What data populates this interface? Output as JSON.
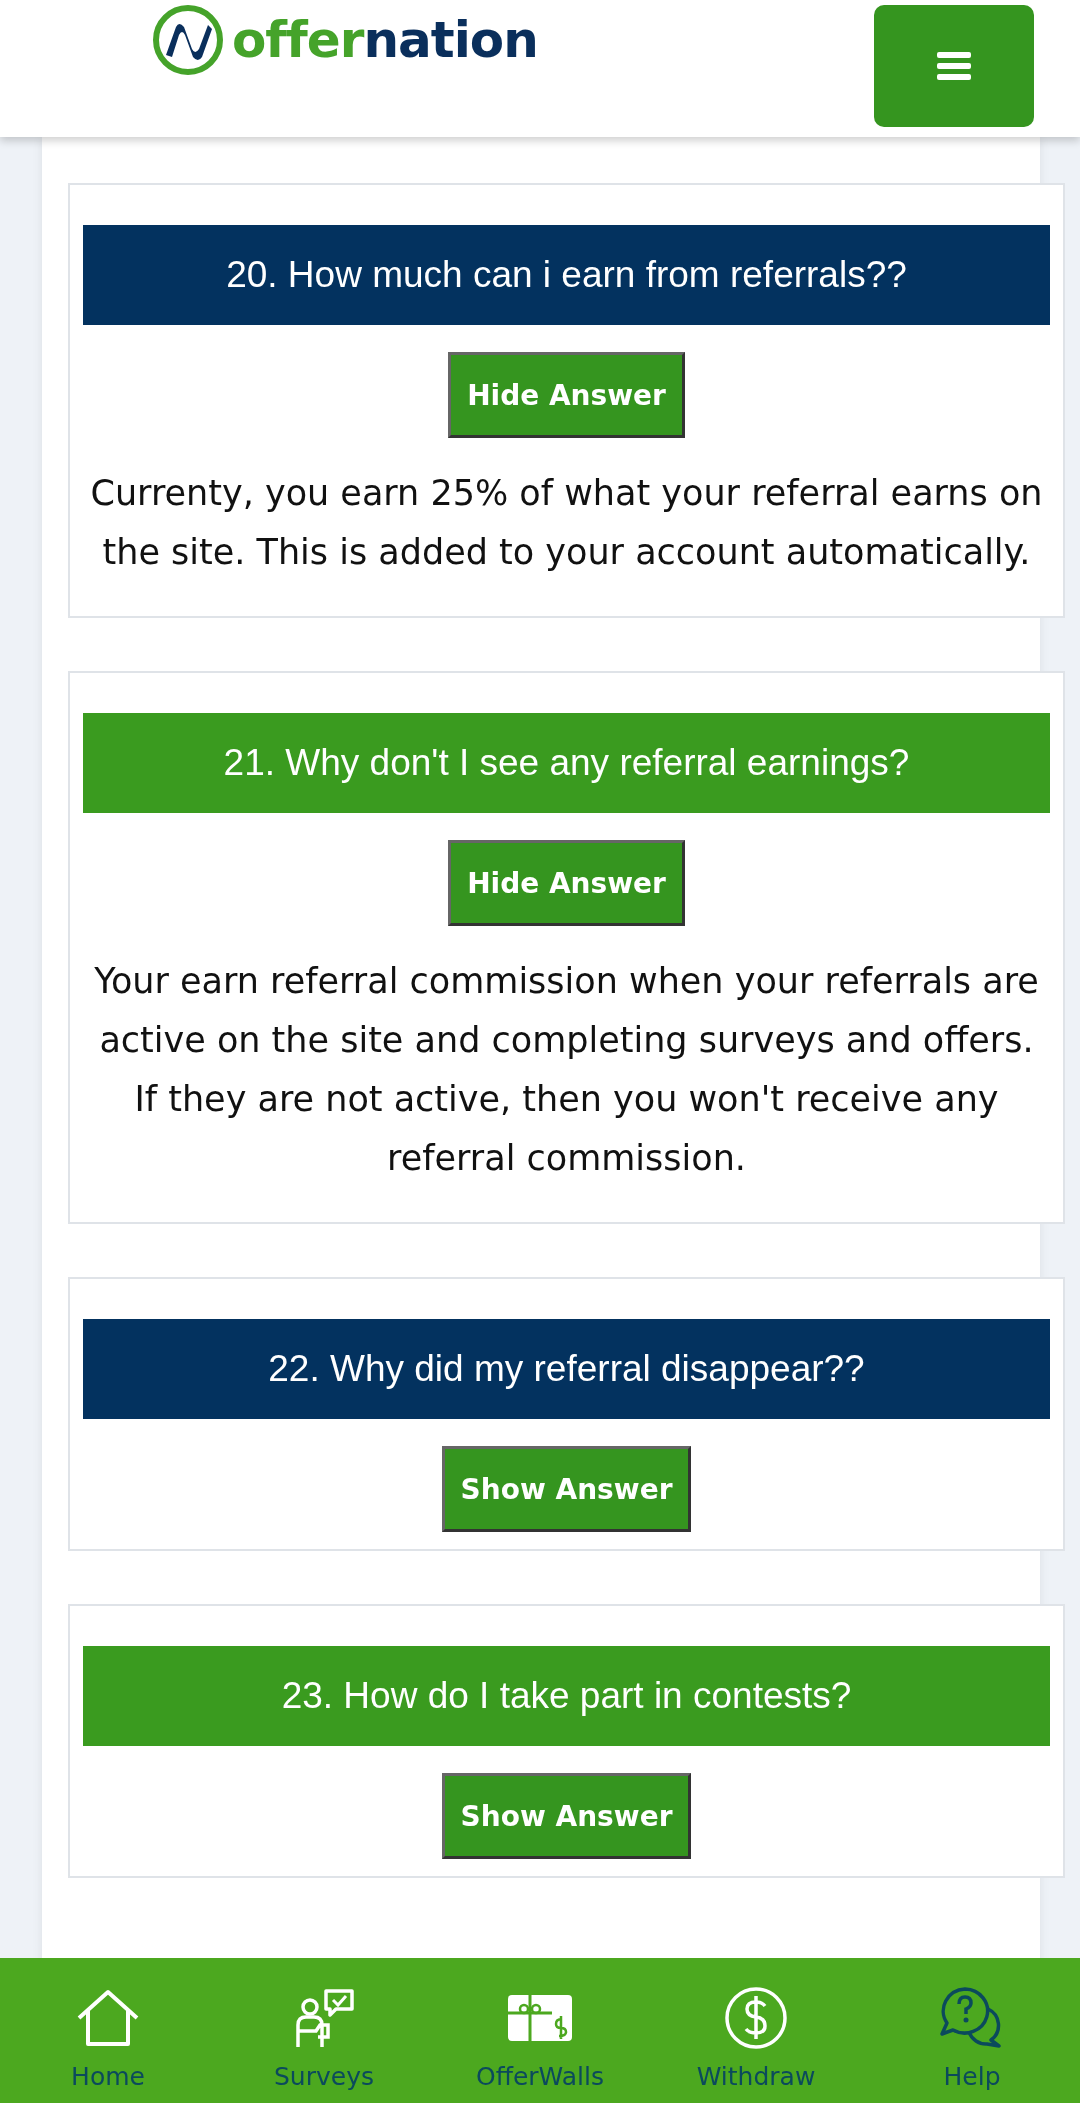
{
  "header": {
    "logo": {
      "first": "offer",
      "second": "nation"
    }
  },
  "faqs": [
    {
      "question": "20. How much can i earn from referrals??",
      "color": "#03325f",
      "button": "Hide Answer",
      "answer": "Currenty, you earn 25% of what your referral earns on the site. This is added to your account automatically."
    },
    {
      "question": "21. Why don't I see any referral earnings?",
      "color": "#3a9b1f",
      "button": "Hide Answer",
      "answer": "Your earn referral commission when your referrals are active on the site and completing surveys and offers. If they are not active, then you won't receive any referral commission."
    },
    {
      "question": "22. Why did my referral disappear??",
      "color": "#03325f",
      "button": "Show Answer"
    },
    {
      "question": "23. How do I take part in contests?",
      "color": "#3a9b1f",
      "button": "Show Answer"
    }
  ],
  "bottom_nav": [
    {
      "kind": "home",
      "label": "Home",
      "selected": false
    },
    {
      "kind": "surveys",
      "label": "Surveys",
      "selected": false
    },
    {
      "kind": "offerwalls",
      "label": "OfferWalls",
      "selected": false
    },
    {
      "kind": "withdraw",
      "label": "Withdraw",
      "selected": false
    },
    {
      "kind": "help",
      "label": "Help",
      "selected": true
    }
  ]
}
